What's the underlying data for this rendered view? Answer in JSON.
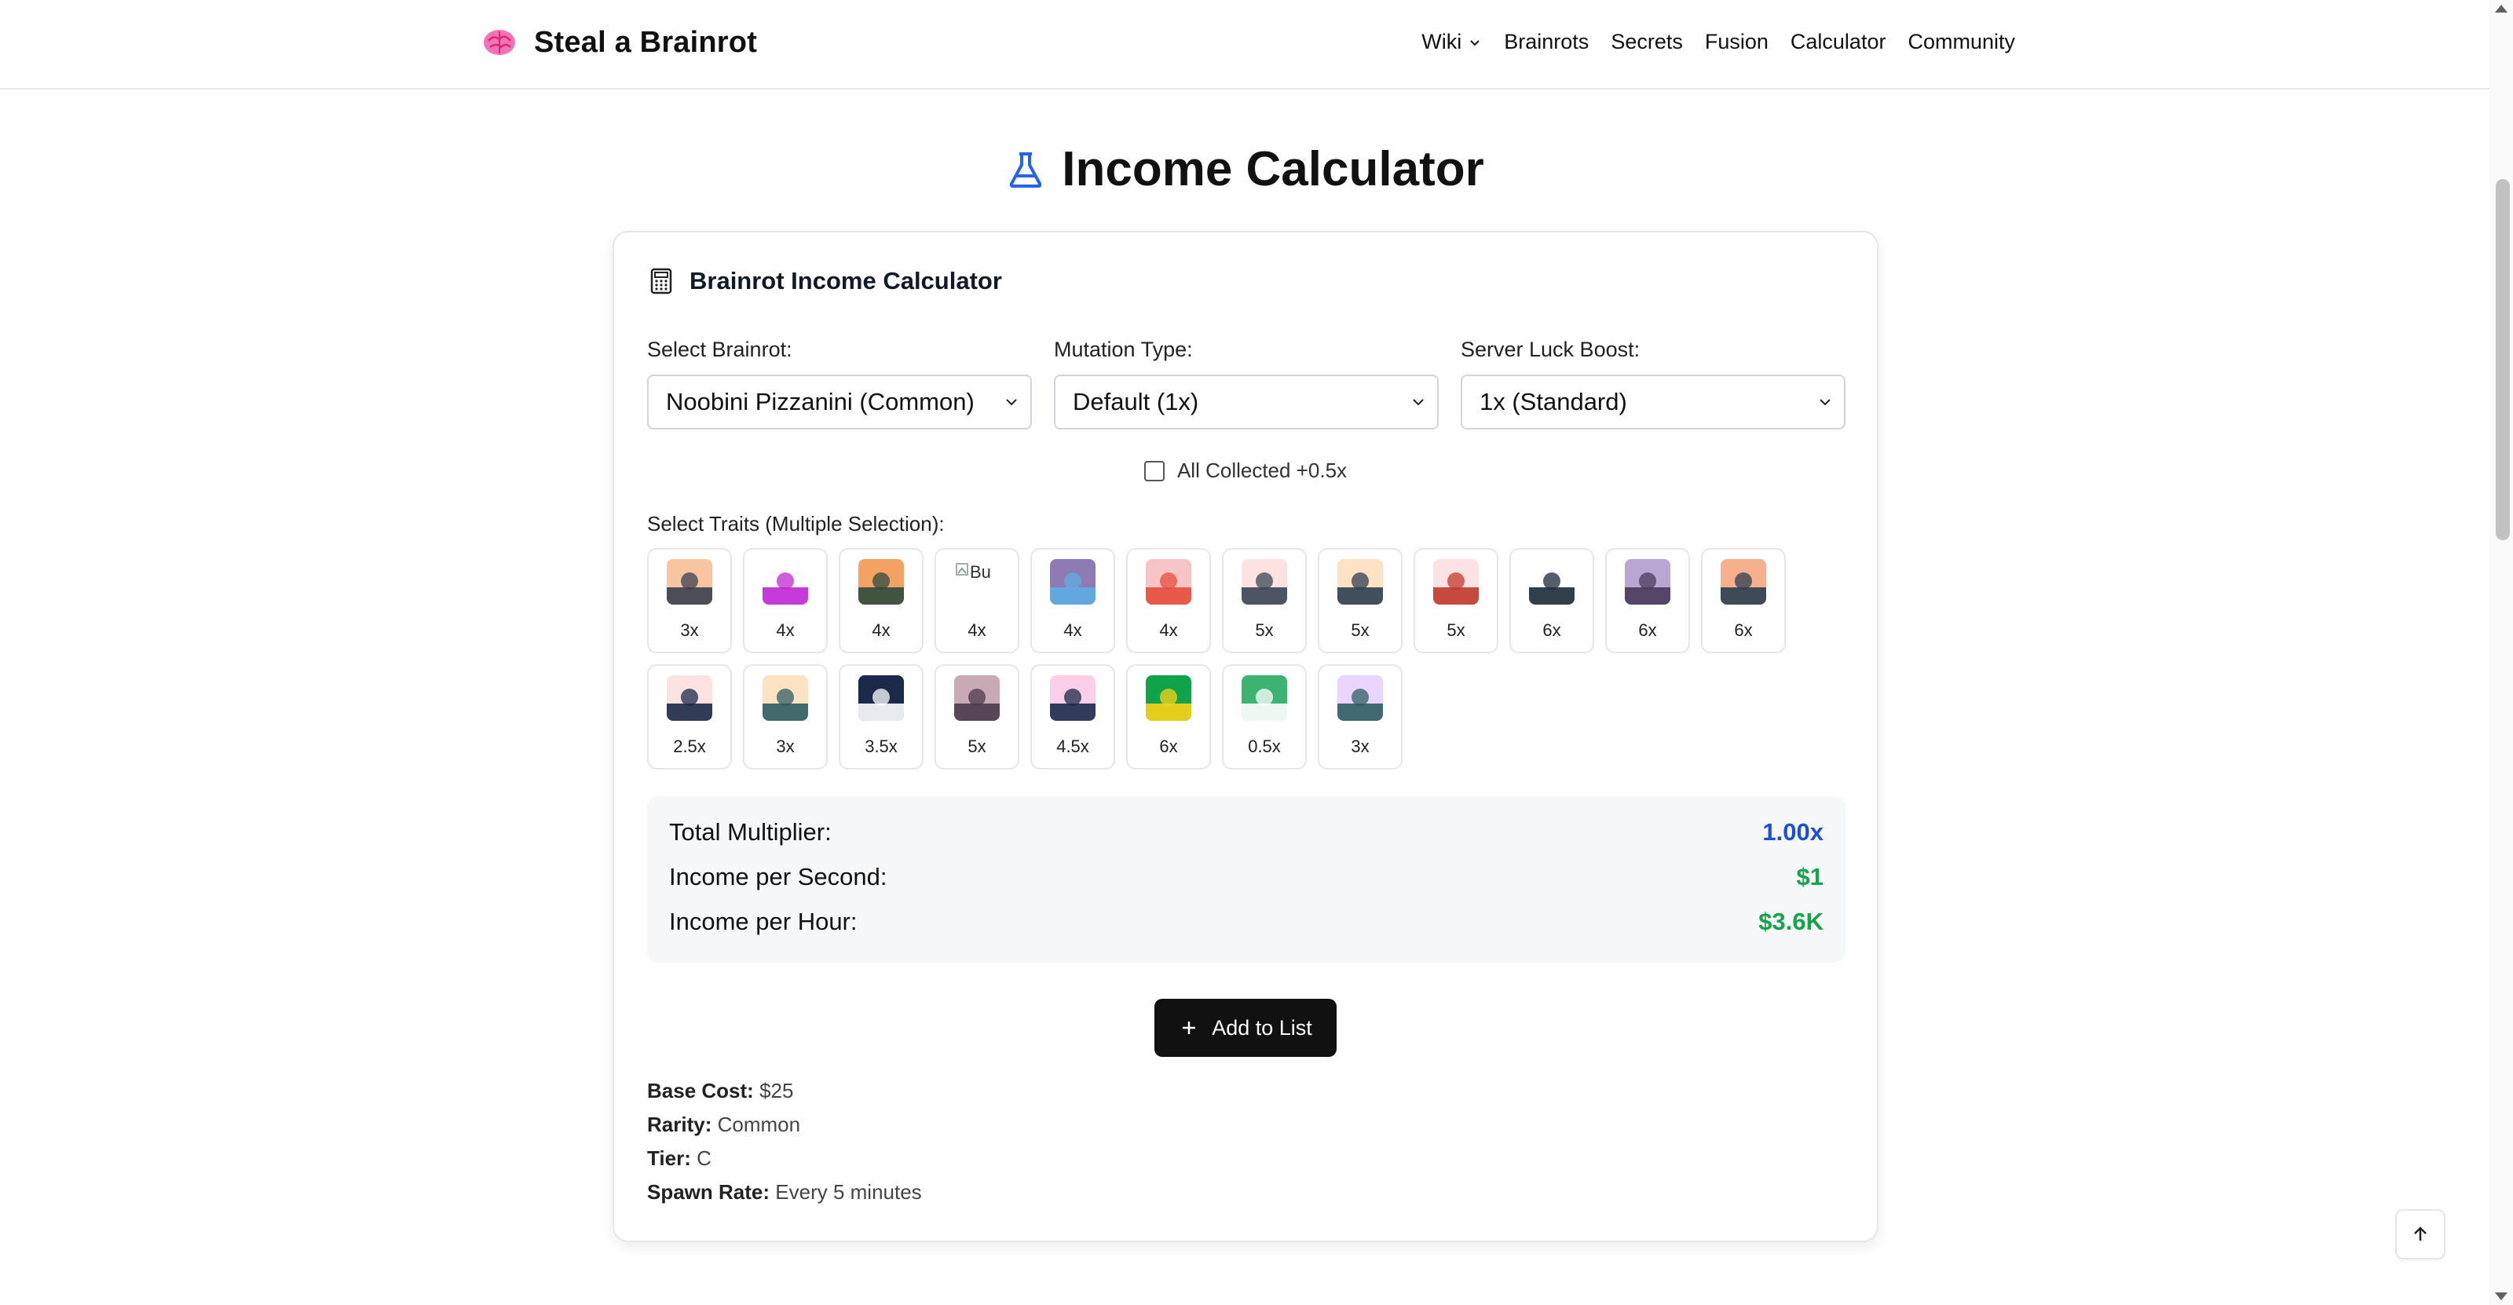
{
  "brand": {
    "name": "Steal a Brainrot"
  },
  "nav": [
    "Wiki",
    "Brainrots",
    "Secrets",
    "Fusion",
    "Calculator",
    "Community"
  ],
  "page_title": "Income Calculator",
  "card_title": "Brainrot Income Calculator",
  "fields": {
    "brainrot": {
      "label": "Select Brainrot:",
      "value": "Noobini Pizzanini (Common)"
    },
    "mutation": {
      "label": "Mutation Type:",
      "value": "Default (1x)"
    },
    "luck": {
      "label": "Server Luck Boost:",
      "value": "1x (Standard)"
    }
  },
  "all_collected": {
    "label": "All Collected +0.5x",
    "checked": false
  },
  "traits_label": "Select Traits (Multiple Selection):",
  "traits": [
    {
      "mult": "3x",
      "icon": "sunset-icon",
      "bg": "#f7c59f",
      "fg": "#3a3f4f"
    },
    {
      "mult": "4x",
      "icon": "portal-ring-icon",
      "bg": "#ffffff",
      "fg": "#c026d3"
    },
    {
      "mult": "4x",
      "icon": "dragon-icon",
      "bg": "#f4a261",
      "fg": "#2d4a3e"
    },
    {
      "mult": "4x",
      "icon": "broken-image-icon",
      "alt": "Bu",
      "bg": "#ffffff",
      "fg": "#888888"
    },
    {
      "mult": "4x",
      "icon": "shark-fin-icon",
      "bg": "#8e7ab5",
      "fg": "#5dade2"
    },
    {
      "mult": "4x",
      "icon": "text-sign-icon",
      "bg": "#f7c5c5",
      "fg": "#e74c3c"
    },
    {
      "mult": "5x",
      "icon": "tower-icon",
      "bg": "#fde2e2",
      "fg": "#3a4556"
    },
    {
      "mult": "5x",
      "icon": "landscape-icon",
      "bg": "#fde2c4",
      "fg": "#2c3e50"
    },
    {
      "mult": "5x",
      "icon": "wave-icon",
      "bg": "#fde2e2",
      "fg": "#c0392b"
    },
    {
      "mult": "6x",
      "icon": "star-burst-icon",
      "bg": "#ffffff",
      "fg": "#1b2a3a"
    },
    {
      "mult": "6x",
      "icon": "nyan-cat-icon",
      "bg": "#b9a6d3",
      "fg": "#4a3b5c"
    },
    {
      "mult": "6x",
      "icon": "fire-icon",
      "bg": "#f6b08e",
      "fg": "#2c3e50"
    },
    {
      "mult": "2.5x",
      "icon": "water-drop-icon",
      "bg": "#fde2e2",
      "fg": "#1b2a4a"
    },
    {
      "mult": "3x",
      "icon": "snowflake-icon",
      "bg": "#fde2c4",
      "fg": "#2f5d62"
    },
    {
      "mult": "3.5x",
      "icon": "night-sky-icon",
      "bg": "#1b2a4a",
      "fg": "#ffffff"
    },
    {
      "mult": "5x",
      "icon": "sparkle-icon",
      "bg": "#c9a9b5",
      "fg": "#4a3b4a"
    },
    {
      "mult": "4.5x",
      "icon": "hat-icon",
      "bg": "#fbcfe8",
      "fg": "#1b2a4a"
    },
    {
      "mult": "6x",
      "icon": "brazil-flag-icon",
      "bg": "#10a34a",
      "fg": "#fcd116"
    },
    {
      "mult": "0.5x",
      "icon": "z-letter-icon",
      "bg": "#3cb371",
      "fg": "#ffffff"
    },
    {
      "mult": "3x",
      "icon": "ufo-icon",
      "bg": "#e9d5ff",
      "fg": "#2f5d62"
    }
  ],
  "results": {
    "total_multiplier": {
      "label": "Total Multiplier:",
      "value": "1.00x",
      "color": "#1d4ed8"
    },
    "income_second": {
      "label": "Income per Second:",
      "value": "$1",
      "color": "#16a34a"
    },
    "income_hour": {
      "label": "Income per Hour:",
      "value": "$3.6K",
      "color": "#16a34a"
    }
  },
  "add_button": "Add to List",
  "info": {
    "base_cost": {
      "label": "Base Cost:",
      "value": "$25"
    },
    "rarity": {
      "label": "Rarity:",
      "value": "Common"
    },
    "tier": {
      "label": "Tier:",
      "value": "C"
    },
    "spawn_rate": {
      "label": "Spawn Rate:",
      "value": "Every 5 minutes"
    }
  }
}
